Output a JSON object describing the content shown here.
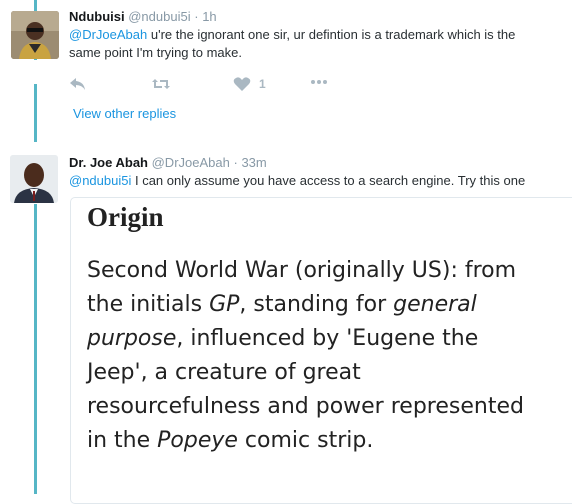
{
  "reply1": {
    "name": "Ndubuisi",
    "handle": "@ndubui5i",
    "separator": "·",
    "time": "1h",
    "mention": "@DrJoeAbah",
    "text_rest": " u're the ignorant one sir, ur defintion is a trademark which is the",
    "text_line2": "same point I'm trying to make.",
    "like_count": "1"
  },
  "view_other_replies": "View other replies",
  "reply2": {
    "name": "Dr. Joe Abah",
    "handle": "@DrJoeAbah",
    "separator": "·",
    "time": "33m",
    "mention": "@ndubui5i",
    "text_rest": " I can only assume you have access to a search engine. Try this one"
  },
  "card": {
    "title": "Origin",
    "line1": "Second World War (originally US): from",
    "line2_a": "the initials ",
    "line2_i": "GP",
    "line2_b": ", standing for ",
    "line2_i2": "general",
    "line3_i": "purpose",
    "line3_b": ", influenced by 'Eugene the",
    "line4": "Jeep', a creature of great",
    "line5": "resourcefulness and power represented",
    "line6_a": "in the ",
    "line6_i": "Popeye",
    "line6_b": " comic strip."
  },
  "icons": {
    "reply": "reply-icon",
    "retweet": "retweet-icon",
    "like": "heart-icon",
    "more": "more-icon"
  },
  "colors": {
    "thread_line": "#56b6c6",
    "link": "#1b95e0",
    "muted": "#8899a6"
  }
}
